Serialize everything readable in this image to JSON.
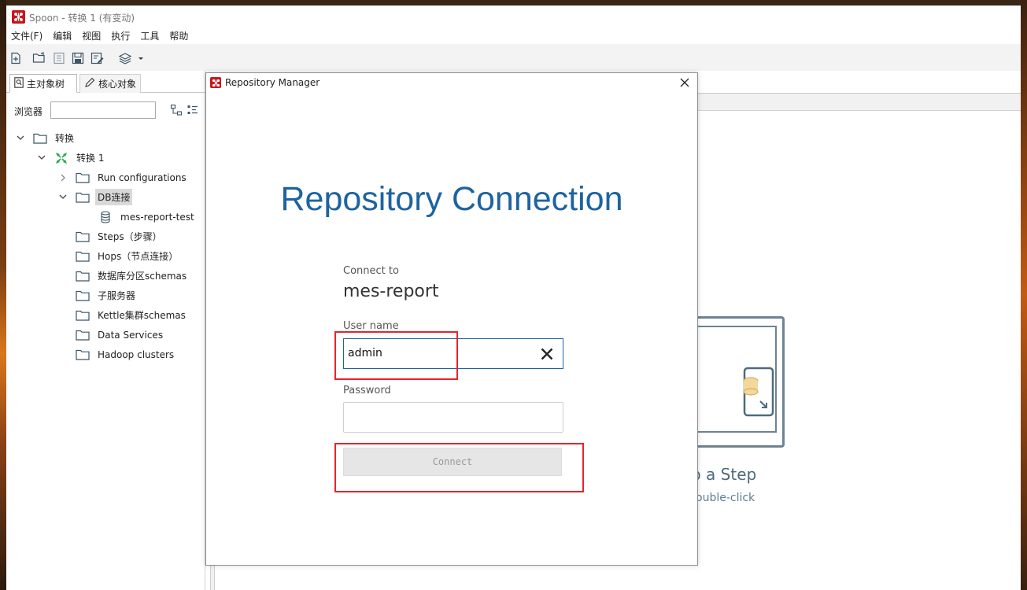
{
  "window": {
    "title": "Spoon - 转换 1 (有变动)"
  },
  "menubar": {
    "items": [
      "文件(F)",
      "编辑",
      "视图",
      "执行",
      "工具",
      "帮助"
    ]
  },
  "toolbar": {
    "icons": [
      "new-file-icon",
      "open-folder-icon",
      "explore-repository-icon",
      "save-icon",
      "save-as-icon",
      "perspective-layers-icon"
    ]
  },
  "left_panel": {
    "tabs": [
      "主对象树",
      "核心对象"
    ],
    "browser_label": "浏览器",
    "browser_value": "",
    "tree": [
      {
        "label": "转换",
        "icon": "folder-icon",
        "expanded": true
      },
      {
        "label": "转换 1",
        "icon": "transformation-icon",
        "expanded": true
      },
      {
        "label": "Run configurations",
        "icon": "folder-icon",
        "expanded": false
      },
      {
        "label": "DB连接",
        "icon": "folder-icon",
        "expanded": true,
        "selected": true
      },
      {
        "label": "mes-report-test",
        "icon": "database-icon"
      },
      {
        "label": "Steps（步骤）",
        "icon": "folder-icon"
      },
      {
        "label": "Hops（节点连接）",
        "icon": "folder-icon"
      },
      {
        "label": "数据库分区schemas",
        "icon": "folder-icon"
      },
      {
        "label": "子服务器",
        "icon": "folder-icon"
      },
      {
        "label": "Kettle集群schemas",
        "icon": "folder-icon"
      },
      {
        "label": "Data Services",
        "icon": "folder-icon"
      },
      {
        "label": "Hadoop clusters",
        "icon": "folder-icon"
      }
    ]
  },
  "canvas_hint": {
    "title": "p a Step",
    "subtitle": "ouble-click"
  },
  "dialog": {
    "title": "Repository Manager",
    "heading": "Repository Connection",
    "connect_to_label": "Connect to",
    "repository_name": "mes-report",
    "username_label": "User name",
    "username_value": "admin",
    "password_label": "Password",
    "password_value": "",
    "connect_button": "Connect"
  },
  "colors": {
    "brand_red": "#c8161d",
    "heading_blue": "#1e63a0",
    "annotation_red": "#e8232a"
  }
}
